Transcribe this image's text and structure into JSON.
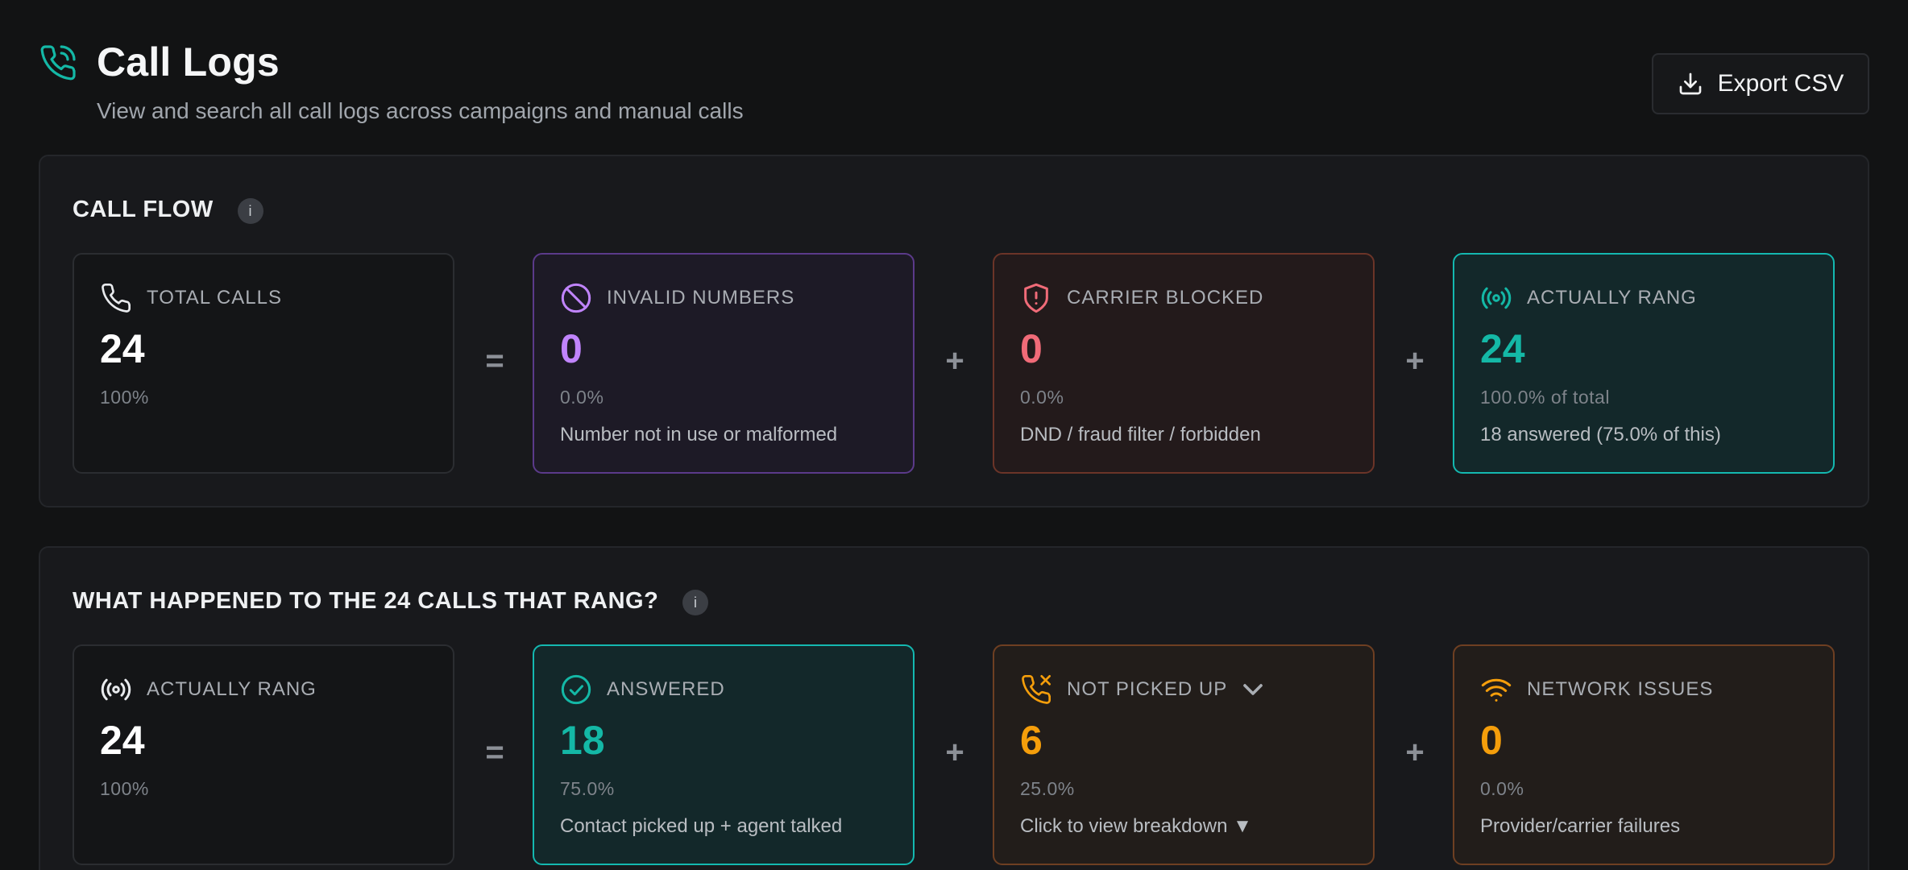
{
  "header": {
    "title": "Call Logs",
    "subtitle": "View and search all call logs across campaigns and manual calls",
    "export_label": "Export CSV"
  },
  "call_flow": {
    "title": "CALL FLOW",
    "info": "i",
    "cards": [
      {
        "label": "TOTAL CALLS",
        "value": "24",
        "pct": "100%",
        "desc": ""
      },
      {
        "label": "INVALID NUMBERS",
        "value": "0",
        "pct": "0.0%",
        "desc": "Number not in use or malformed"
      },
      {
        "label": "CARRIER BLOCKED",
        "value": "0",
        "pct": "0.0%",
        "desc": "DND / fraud filter / forbidden"
      },
      {
        "label": "ACTUALLY RANG",
        "value": "24",
        "pct": "100.0% of total",
        "desc": "18 answered (75.0% of this)"
      }
    ],
    "operators": [
      "=",
      "+",
      "+"
    ]
  },
  "rang_breakdown": {
    "title": "WHAT HAPPENED TO THE 24 CALLS THAT RANG?",
    "info": "i",
    "cards": [
      {
        "label": "ACTUALLY RANG",
        "value": "24",
        "pct": "100%",
        "desc": ""
      },
      {
        "label": "ANSWERED",
        "value": "18",
        "pct": "75.0%",
        "desc": "Contact picked up + agent talked"
      },
      {
        "label": "NOT PICKED UP",
        "value": "6",
        "pct": "25.0%",
        "desc": "Click to view breakdown ▼"
      },
      {
        "label": "NETWORK ISSUES",
        "value": "0",
        "pct": "0.0%",
        "desc": "Provider/carrier failures"
      }
    ],
    "operators": [
      "=",
      "+",
      "+"
    ]
  },
  "colors": {
    "background": "#121314",
    "teal": "#14b8a6",
    "purple": "#c084fc",
    "red": "#f06b78",
    "orange": "#f59e0b"
  },
  "icons": {
    "header": "phone-call-icon",
    "export": "download-icon",
    "total_calls": "phone-icon",
    "invalid_numbers": "ban-icon",
    "carrier_blocked": "shield-alert-icon",
    "actually_rang": "radio-broadcast-icon",
    "answered": "check-circle-icon",
    "not_picked_up": "phone-missed-icon",
    "network_issues": "wifi-icon"
  }
}
